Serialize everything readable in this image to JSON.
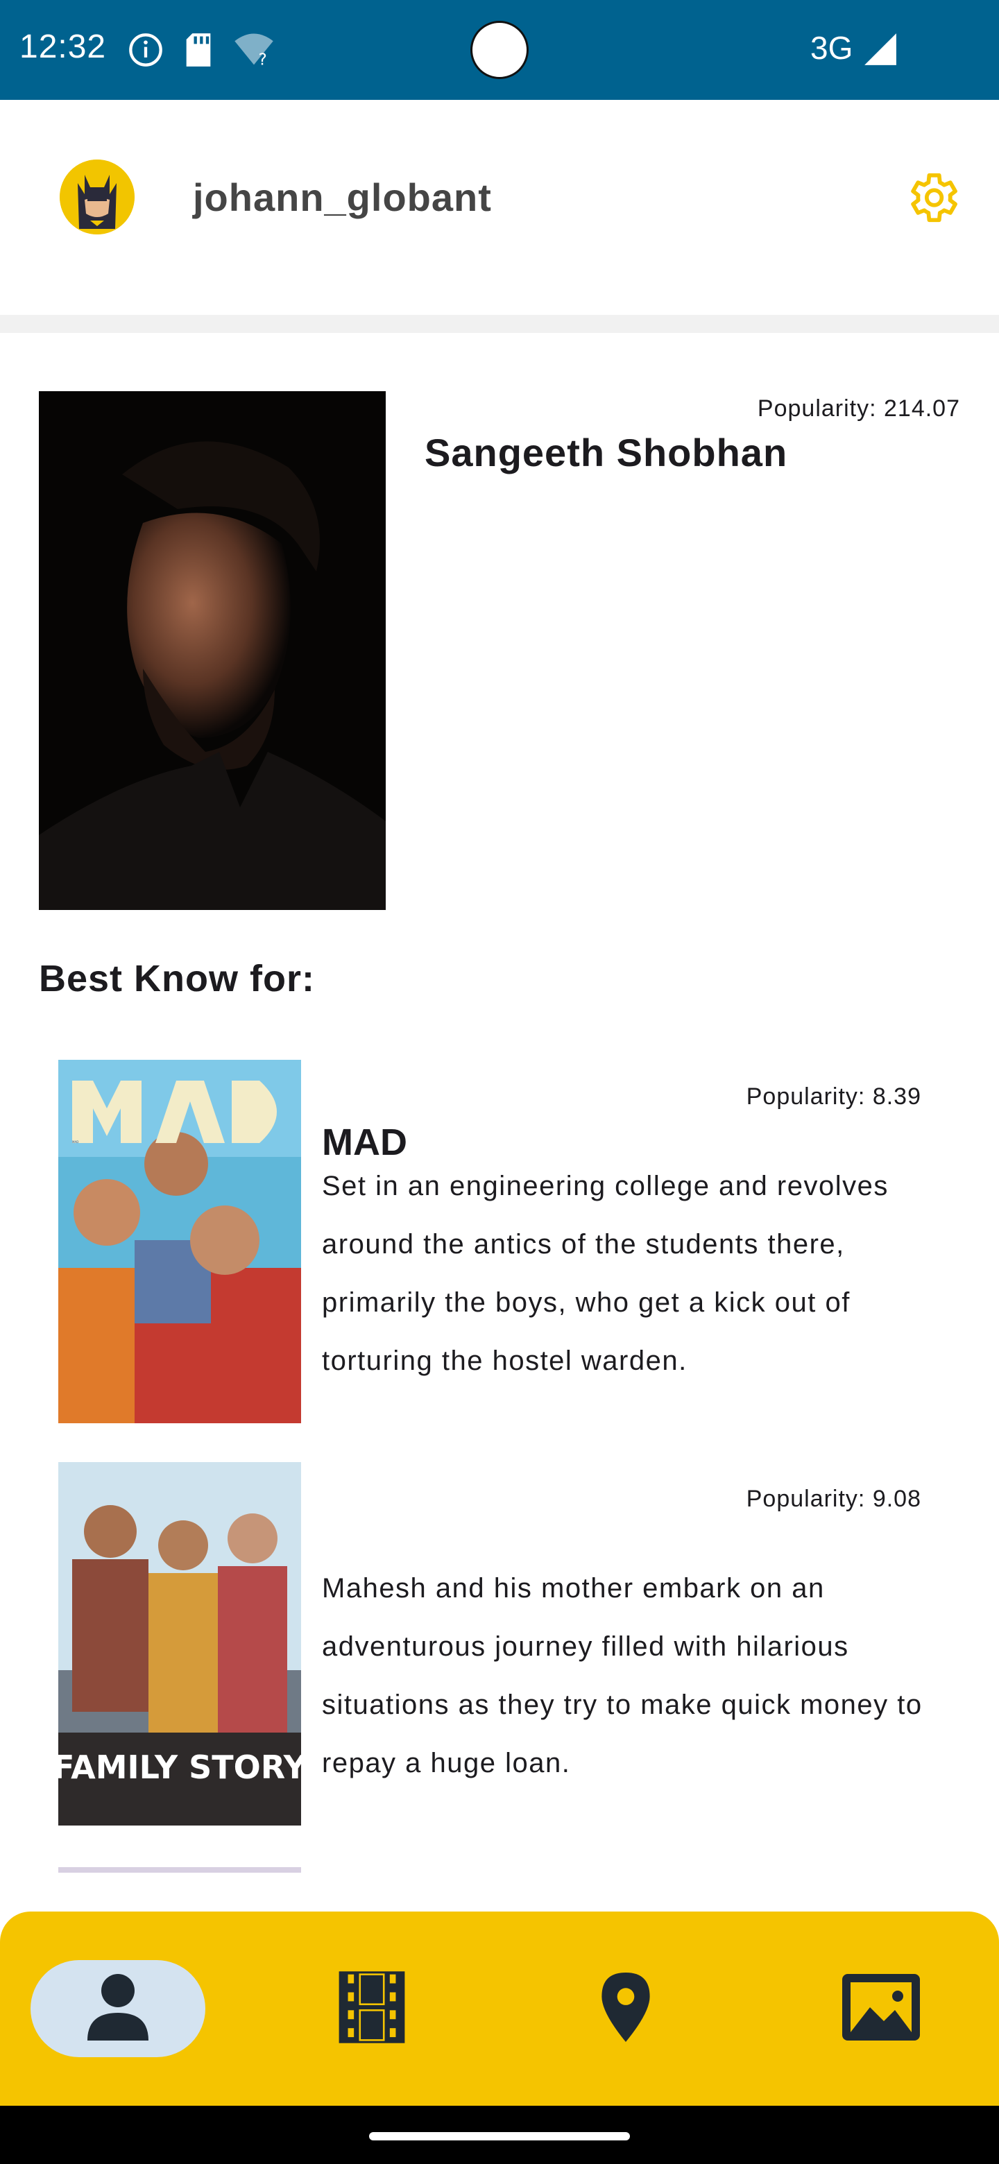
{
  "status_bar": {
    "time": "12:32",
    "network": "3G",
    "background_color": "#00628f"
  },
  "header": {
    "username": "johann_globant",
    "avatar_icon": "batman-avatar-icon",
    "settings_icon": "gear-icon",
    "accent_color": "#f5c400"
  },
  "person": {
    "name": "Sangeeth Shobhan",
    "popularity": "Popularity: 214.07"
  },
  "known_for": {
    "title": "Best Know for:",
    "movies": [
      {
        "title": "MAD",
        "popularity": "Popularity: 8.39",
        "overview": "Set in an engineering college and revolves around the antics of the students there, primarily the boys, who get a kick out of torturing the hostel warden.",
        "poster_text": "MAD"
      },
      {
        "title": "",
        "popularity": "Popularity: 9.08",
        "overview": "Mahesh and his mother embark on an adventurous journey filled with hilarious situations as they try to make quick money to repay a huge loan.",
        "poster_text": "FAMILY STORY"
      }
    ]
  },
  "bottom_nav": {
    "items": [
      {
        "icon": "person-icon",
        "active": true
      },
      {
        "icon": "film-icon",
        "active": false
      },
      {
        "icon": "location-pin-icon",
        "active": false
      },
      {
        "icon": "image-icon",
        "active": false
      }
    ],
    "background_color": "#f5c400"
  }
}
